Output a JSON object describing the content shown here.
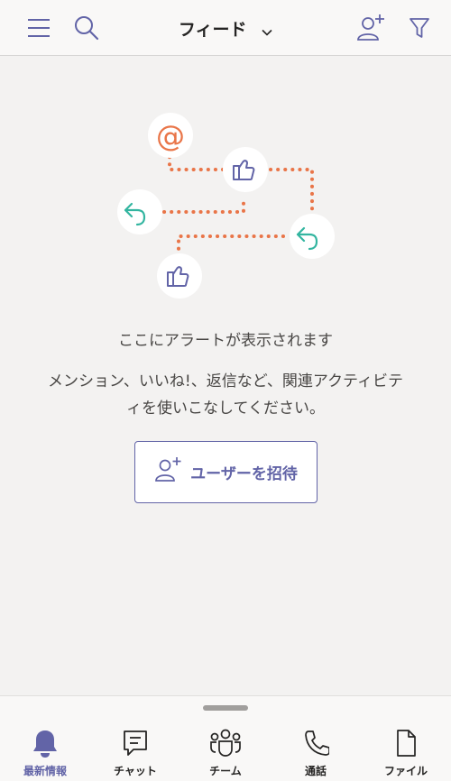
{
  "header": {
    "title": "フィード",
    "menu_icon": "hamburger-menu-icon",
    "search_icon": "search-icon",
    "add_person_icon": "add-person-icon",
    "filter_icon": "filter-icon"
  },
  "empty_state": {
    "title": "ここにアラートが表示されます",
    "description": "メンション、いいね!、返信など、関連アクティビティを使いこなしてください。",
    "invite_button_label": "ユーザーを招待",
    "illustration_icons": [
      "at-mention-icon",
      "like-icon",
      "reply-icon",
      "reply-icon",
      "like-icon"
    ]
  },
  "tabbar": {
    "tabs": [
      {
        "label": "最新情報",
        "icon": "bell-icon",
        "active": true
      },
      {
        "label": "チャット",
        "icon": "chat-icon",
        "active": false
      },
      {
        "label": "チーム",
        "icon": "teams-icon",
        "active": false
      },
      {
        "label": "通話",
        "icon": "phone-icon",
        "active": false
      },
      {
        "label": "ファイル",
        "icon": "file-icon",
        "active": false
      }
    ]
  },
  "colors": {
    "accent": "#6264a7",
    "illustration_orange": "#e97548",
    "illustration_teal": "#33b5a0",
    "background": "#f3f2f1"
  }
}
